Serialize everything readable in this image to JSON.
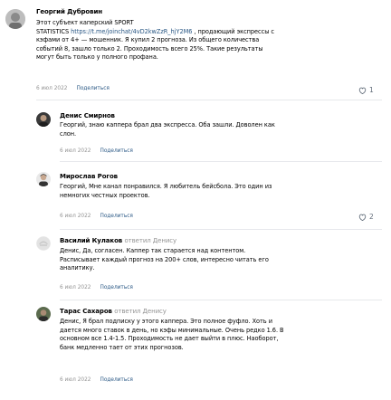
{
  "comments": [
    {
      "author": "Георгий Дубровин",
      "lines": [
        "Этот субъект каперский SPORT",
        "",
        "кэфами от 4+ — мошенник. Я купил 2 прогноза. Из общего количества",
        "событий 8, зашло только 2. Проходимость всего 25%. Такие результаты",
        "могут быть только у полного профана."
      ],
      "line2_prefix": "STATISTICS ",
      "line2_link": "https://t.me/joinchat/4vD2kwZzR_hjY2M6",
      "line2_suffix": " , продающий экспрессы с",
      "date": "6 июл 2022",
      "reply_label": "Поделиться",
      "likes": "1"
    },
    {
      "author": "Денис Смирнов",
      "lines": [
        "Георгий, знаю каппера брал два экспресса. Оба зашли. Доволен как",
        "слон."
      ],
      "date": "6 июл 2022",
      "reply_label": "Поделиться"
    },
    {
      "author": "Мирослав Рогов",
      "lines": [
        "Георгий, Мне канал понравился. Я любитель бейсбола. Это один из",
        "немногих честных проектов."
      ],
      "date": "6 июл 2022",
      "reply_label": "Поделиться",
      "likes": "2"
    },
    {
      "author": "Василий Кулаков",
      "reply_to": "ответил Денису",
      "lines": [
        "Денис, Да, согласен. Каппер так старается над контентом.",
        "Расписывает каждый прогноз на 200+ слов, интересно читать его",
        "аналитику."
      ],
      "date": "6 июл 2022",
      "reply_label": "Поделиться"
    },
    {
      "author": "Тарас Сахаров",
      "reply_to": "ответил Денису",
      "lines": [
        "Денис, Я брал подписку у этого каппера. Это полное фуфло. Хоть и",
        "дается много ставок в день, но кэфы минимальные. Очень редко 1.6. В",
        "основном все 1.4-1.5. Проходимость не дает выйти в плюс. Наоборот,",
        "банк медленно тает от этих прогнозов."
      ],
      "date": "6 июл 2022",
      "reply_label": "Поделиться"
    }
  ],
  "colors": {
    "link": "#2a5885",
    "muted": "#939393",
    "separator": "#e7e8ec"
  },
  "icons": {
    "like": "heart-icon"
  }
}
